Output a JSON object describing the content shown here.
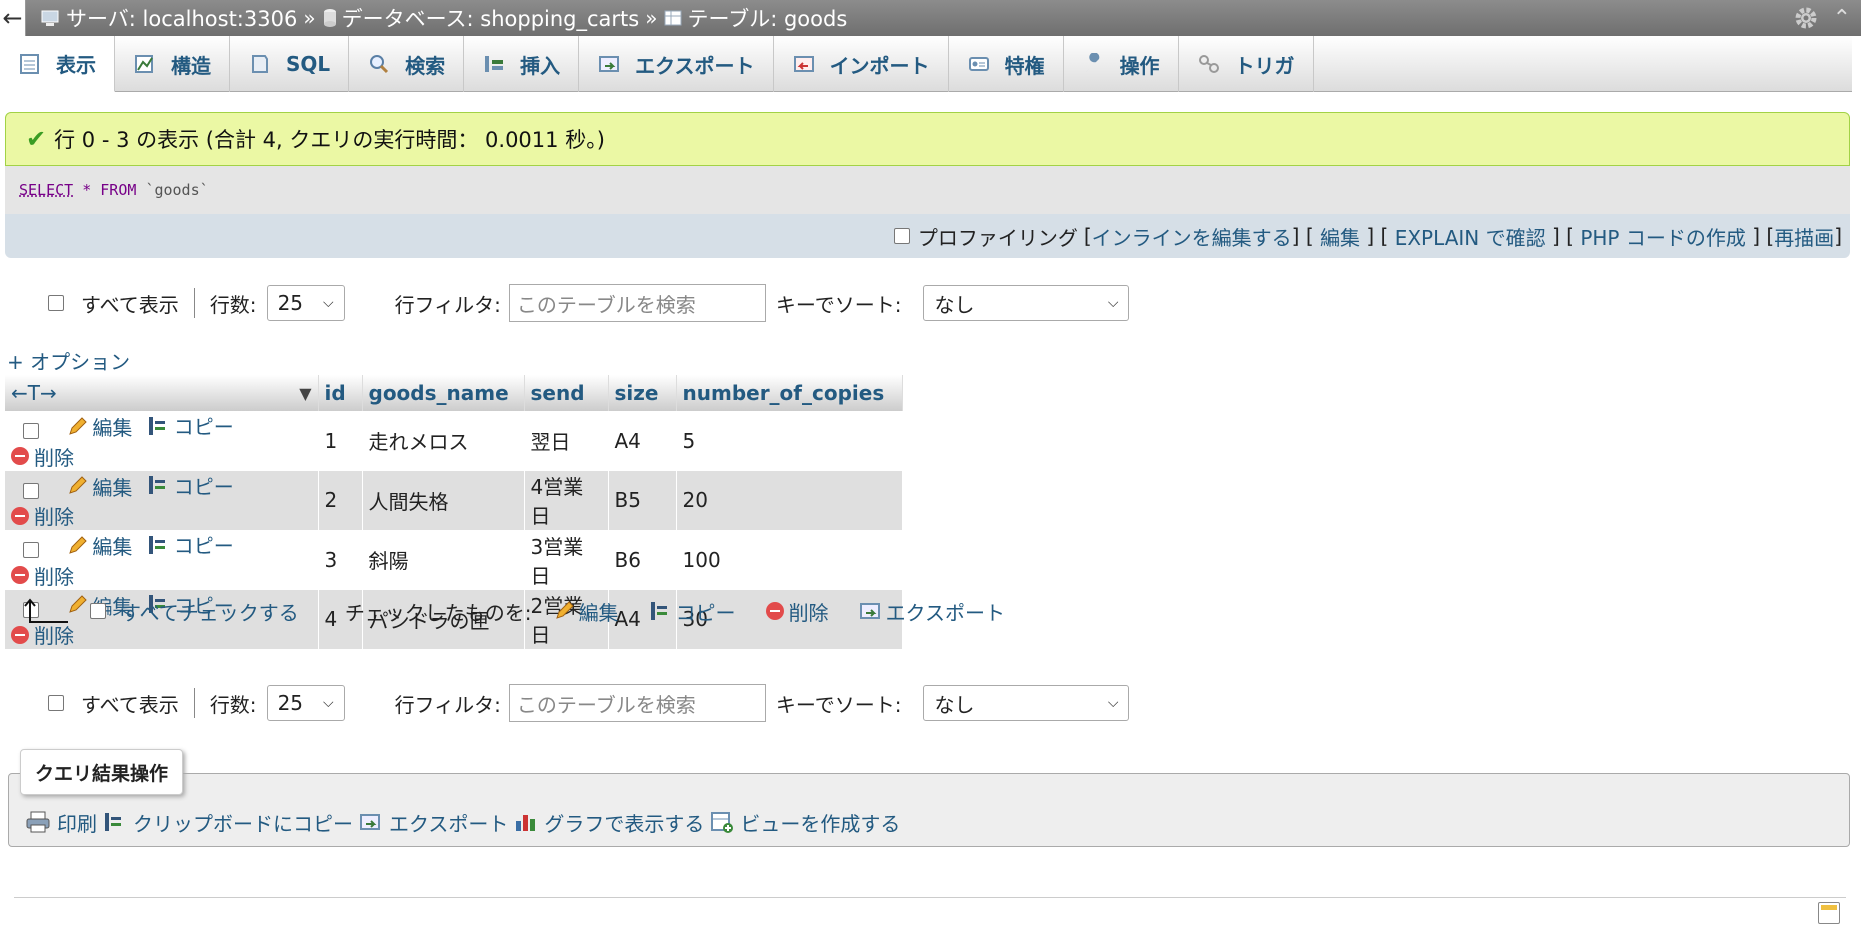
{
  "breadcrumb": {
    "back": "←",
    "server": "サーバ: localhost:3306",
    "separator": "»",
    "database": "データベース: shopping_carts",
    "table": "テーブル: goods"
  },
  "tabs": [
    {
      "label": "表示"
    },
    {
      "label": "構造"
    },
    {
      "label": "SQL"
    },
    {
      "label": "検索"
    },
    {
      "label": "挿入"
    },
    {
      "label": "エクスポート"
    },
    {
      "label": "インポート"
    },
    {
      "label": "特権"
    },
    {
      "label": "操作"
    },
    {
      "label": "トリガ"
    }
  ],
  "message": {
    "text": "行 0 - 3 の表示 (合計 4, クエリの実行時間： 0.0011 秒。)",
    "color": "#ebf8a4"
  },
  "query": {
    "select": "SELECT",
    "star": "*",
    "from": "FROM",
    "table": "`goods`"
  },
  "querytools": {
    "profiling": "プロファイリング",
    "lb": "[",
    "rb": "]",
    "inline_edit": "インラインを編集する",
    "edit": "編集",
    "explain": "EXPLAIN で確認",
    "php": "PHP コードの作成",
    "refresh": "再描画"
  },
  "nav": {
    "show_all": "すべて表示",
    "rows_label": "行数:",
    "rows_value": "25",
    "filter_label": "行フィルタ:",
    "filter_placeholder": "このテーブルを検索",
    "sort_label": "キーでソート:",
    "sort_value": "なし"
  },
  "options": "+ オプション",
  "table": {
    "arrows": "←T→",
    "headers": [
      "id",
      "goods_name",
      "send",
      "size",
      "number_of_copies"
    ],
    "actions": {
      "edit": "編集",
      "copy": "コピー",
      "delete": "削除"
    },
    "rows": [
      {
        "id": "1",
        "goods_name": "走れメロス",
        "send": "翌日",
        "size": "A4",
        "copies": "5"
      },
      {
        "id": "2",
        "goods_name": "人間失格",
        "send": "4営業日",
        "size": "B5",
        "copies": "20"
      },
      {
        "id": "3",
        "goods_name": "斜陽",
        "send": "3営業日",
        "size": "B6",
        "copies": "100"
      },
      {
        "id": "4",
        "goods_name": "パンドラの匣",
        "send": "2営業日",
        "size": "A4",
        "copies": "30"
      }
    ]
  },
  "bulk": {
    "check_all": "すべてチェックする",
    "with_selected": "チェックしたものを:",
    "edit": "編集",
    "copy": "コピー",
    "delete": "削除",
    "export": "エクスポート"
  },
  "query_ops": {
    "legend": "クエリ結果操作",
    "print": "印刷",
    "clipboard": "クリップボードにコピー",
    "export": "エクスポート",
    "chart": "グラフで表示する",
    "view": "ビューを作成する"
  }
}
